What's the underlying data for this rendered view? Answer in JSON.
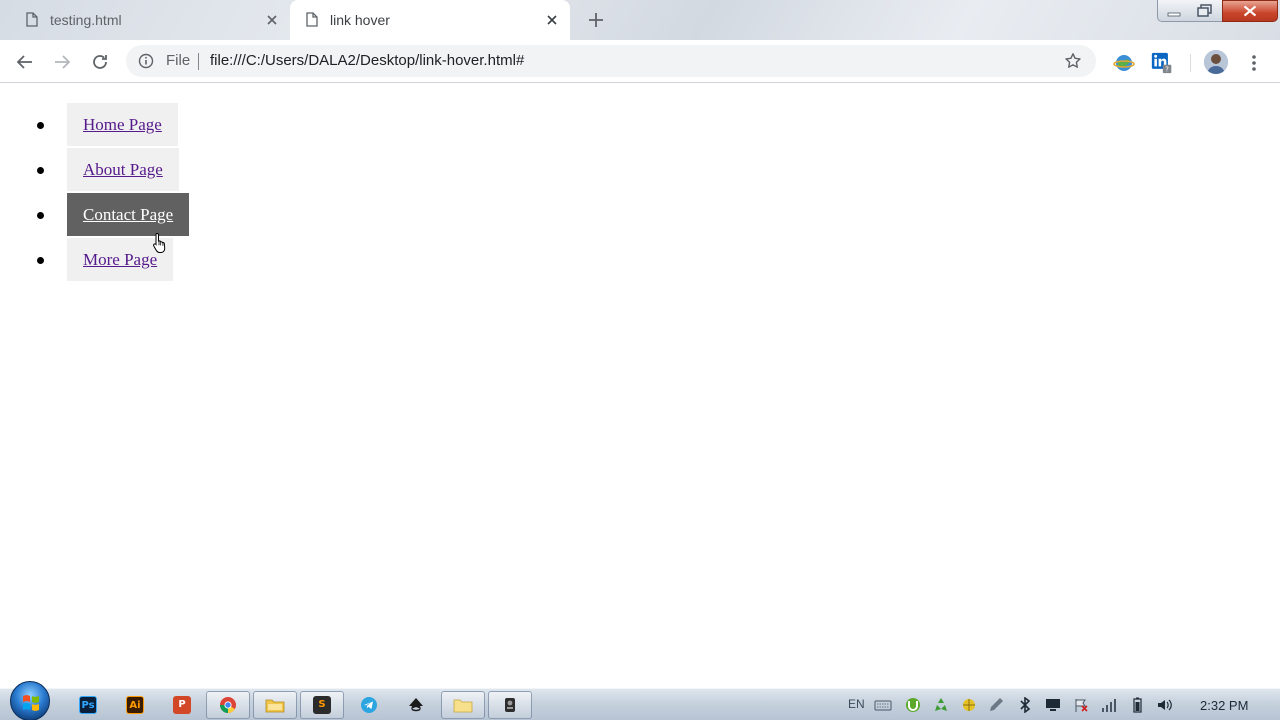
{
  "browser": {
    "tabs": [
      {
        "title": "testing.html",
        "active": false
      },
      {
        "title": "link hover",
        "active": true
      }
    ],
    "address_bar": {
      "scheme_label": "File",
      "url": "file:///C:/Users/DALA2/Desktop/link-hover.html#"
    }
  },
  "page": {
    "nav_links": [
      {
        "label": "Home Page",
        "hovered": false
      },
      {
        "label": "About Page",
        "hovered": false
      },
      {
        "label": "Contact Page",
        "hovered": true
      },
      {
        "label": "More Page",
        "hovered": false
      }
    ],
    "link_color": "#551a8b",
    "link_bg": "#f0f0f0",
    "hover_bg": "#616161",
    "hover_text": "#ffffff"
  },
  "taskbar": {
    "apps": [
      {
        "name": "photoshop-icon",
        "glyph": "Ps"
      },
      {
        "name": "illustrator-icon",
        "glyph": "Ai"
      },
      {
        "name": "powerpoint-icon",
        "glyph": "P"
      },
      {
        "name": "chrome-icon",
        "glyph": ""
      },
      {
        "name": "file-explorer-icon",
        "glyph": ""
      },
      {
        "name": "sublime-text-icon",
        "glyph": "S"
      },
      {
        "name": "telegram-icon",
        "glyph": ""
      },
      {
        "name": "inkscape-icon",
        "glyph": ""
      },
      {
        "name": "folder-icon",
        "glyph": ""
      },
      {
        "name": "media-app-icon",
        "glyph": ""
      }
    ],
    "language": "EN",
    "clock": "2:32 PM"
  }
}
